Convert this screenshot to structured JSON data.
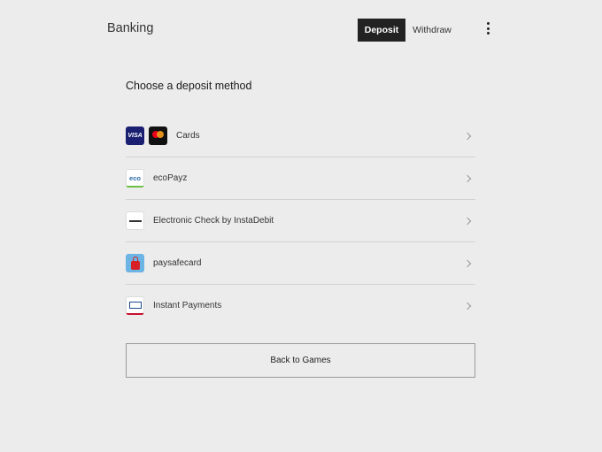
{
  "header": {
    "title": "Banking",
    "tabs": [
      {
        "label": "Deposit",
        "active": true
      },
      {
        "label": "Withdraw",
        "active": false
      }
    ],
    "menu_icon": "more-vertical-icon"
  },
  "main": {
    "heading": "Choose a deposit method",
    "methods": [
      {
        "label": "Cards",
        "icons": [
          "visa-logo",
          "mastercard-logo"
        ]
      },
      {
        "label": "ecoPayz",
        "icons": [
          "ecopayz-logo"
        ]
      },
      {
        "label": "Electronic Check by InstaDebit",
        "icons": [
          "instadebit-logo"
        ]
      },
      {
        "label": "paysafecard",
        "icons": [
          "paysafecard-logo"
        ]
      },
      {
        "label": "Instant Payments",
        "icons": [
          "instant-payments-logo"
        ]
      }
    ],
    "back_button": "Back to Games",
    "logo_text": {
      "visa": "VISA",
      "eco": "eco"
    }
  },
  "colors": {
    "background": "#ececec",
    "active_tab": "#222222",
    "divider": "#d2d2d2"
  }
}
